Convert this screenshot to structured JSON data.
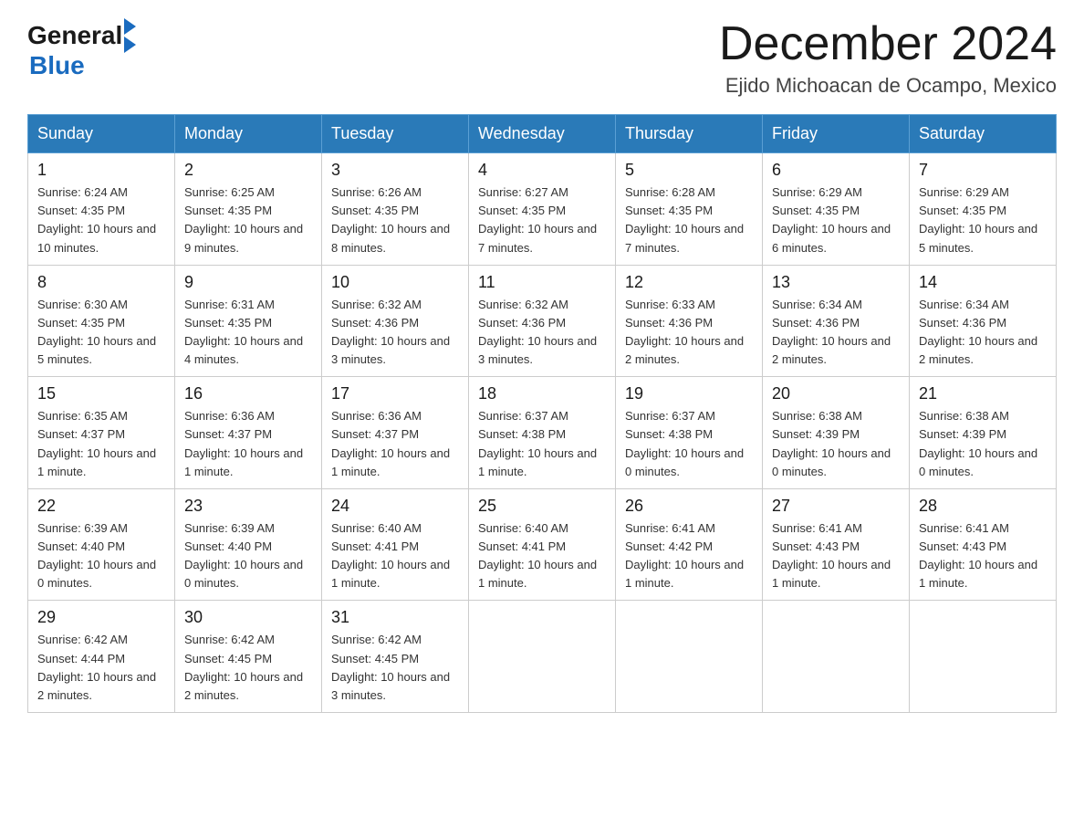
{
  "header": {
    "logo_general": "General",
    "logo_blue": "Blue",
    "month_title": "December 2024",
    "location": "Ejido Michoacan de Ocampo, Mexico"
  },
  "days_of_week": [
    "Sunday",
    "Monday",
    "Tuesday",
    "Wednesday",
    "Thursday",
    "Friday",
    "Saturday"
  ],
  "weeks": [
    [
      {
        "day": "1",
        "sunrise": "6:24 AM",
        "sunset": "4:35 PM",
        "daylight": "10 hours and 10 minutes."
      },
      {
        "day": "2",
        "sunrise": "6:25 AM",
        "sunset": "4:35 PM",
        "daylight": "10 hours and 9 minutes."
      },
      {
        "day": "3",
        "sunrise": "6:26 AM",
        "sunset": "4:35 PM",
        "daylight": "10 hours and 8 minutes."
      },
      {
        "day": "4",
        "sunrise": "6:27 AM",
        "sunset": "4:35 PM",
        "daylight": "10 hours and 7 minutes."
      },
      {
        "day": "5",
        "sunrise": "6:28 AM",
        "sunset": "4:35 PM",
        "daylight": "10 hours and 7 minutes."
      },
      {
        "day": "6",
        "sunrise": "6:29 AM",
        "sunset": "4:35 PM",
        "daylight": "10 hours and 6 minutes."
      },
      {
        "day": "7",
        "sunrise": "6:29 AM",
        "sunset": "4:35 PM",
        "daylight": "10 hours and 5 minutes."
      }
    ],
    [
      {
        "day": "8",
        "sunrise": "6:30 AM",
        "sunset": "4:35 PM",
        "daylight": "10 hours and 5 minutes."
      },
      {
        "day": "9",
        "sunrise": "6:31 AM",
        "sunset": "4:35 PM",
        "daylight": "10 hours and 4 minutes."
      },
      {
        "day": "10",
        "sunrise": "6:32 AM",
        "sunset": "4:36 PM",
        "daylight": "10 hours and 3 minutes."
      },
      {
        "day": "11",
        "sunrise": "6:32 AM",
        "sunset": "4:36 PM",
        "daylight": "10 hours and 3 minutes."
      },
      {
        "day": "12",
        "sunrise": "6:33 AM",
        "sunset": "4:36 PM",
        "daylight": "10 hours and 2 minutes."
      },
      {
        "day": "13",
        "sunrise": "6:34 AM",
        "sunset": "4:36 PM",
        "daylight": "10 hours and 2 minutes."
      },
      {
        "day": "14",
        "sunrise": "6:34 AM",
        "sunset": "4:36 PM",
        "daylight": "10 hours and 2 minutes."
      }
    ],
    [
      {
        "day": "15",
        "sunrise": "6:35 AM",
        "sunset": "4:37 PM",
        "daylight": "10 hours and 1 minute."
      },
      {
        "day": "16",
        "sunrise": "6:36 AM",
        "sunset": "4:37 PM",
        "daylight": "10 hours and 1 minute."
      },
      {
        "day": "17",
        "sunrise": "6:36 AM",
        "sunset": "4:37 PM",
        "daylight": "10 hours and 1 minute."
      },
      {
        "day": "18",
        "sunrise": "6:37 AM",
        "sunset": "4:38 PM",
        "daylight": "10 hours and 1 minute."
      },
      {
        "day": "19",
        "sunrise": "6:37 AM",
        "sunset": "4:38 PM",
        "daylight": "10 hours and 0 minutes."
      },
      {
        "day": "20",
        "sunrise": "6:38 AM",
        "sunset": "4:39 PM",
        "daylight": "10 hours and 0 minutes."
      },
      {
        "day": "21",
        "sunrise": "6:38 AM",
        "sunset": "4:39 PM",
        "daylight": "10 hours and 0 minutes."
      }
    ],
    [
      {
        "day": "22",
        "sunrise": "6:39 AM",
        "sunset": "4:40 PM",
        "daylight": "10 hours and 0 minutes."
      },
      {
        "day": "23",
        "sunrise": "6:39 AM",
        "sunset": "4:40 PM",
        "daylight": "10 hours and 0 minutes."
      },
      {
        "day": "24",
        "sunrise": "6:40 AM",
        "sunset": "4:41 PM",
        "daylight": "10 hours and 1 minute."
      },
      {
        "day": "25",
        "sunrise": "6:40 AM",
        "sunset": "4:41 PM",
        "daylight": "10 hours and 1 minute."
      },
      {
        "day": "26",
        "sunrise": "6:41 AM",
        "sunset": "4:42 PM",
        "daylight": "10 hours and 1 minute."
      },
      {
        "day": "27",
        "sunrise": "6:41 AM",
        "sunset": "4:43 PM",
        "daylight": "10 hours and 1 minute."
      },
      {
        "day": "28",
        "sunrise": "6:41 AM",
        "sunset": "4:43 PM",
        "daylight": "10 hours and 1 minute."
      }
    ],
    [
      {
        "day": "29",
        "sunrise": "6:42 AM",
        "sunset": "4:44 PM",
        "daylight": "10 hours and 2 minutes."
      },
      {
        "day": "30",
        "sunrise": "6:42 AM",
        "sunset": "4:45 PM",
        "daylight": "10 hours and 2 minutes."
      },
      {
        "day": "31",
        "sunrise": "6:42 AM",
        "sunset": "4:45 PM",
        "daylight": "10 hours and 3 minutes."
      },
      null,
      null,
      null,
      null
    ]
  ],
  "labels": {
    "sunrise": "Sunrise: ",
    "sunset": "Sunset: ",
    "daylight": "Daylight: "
  }
}
